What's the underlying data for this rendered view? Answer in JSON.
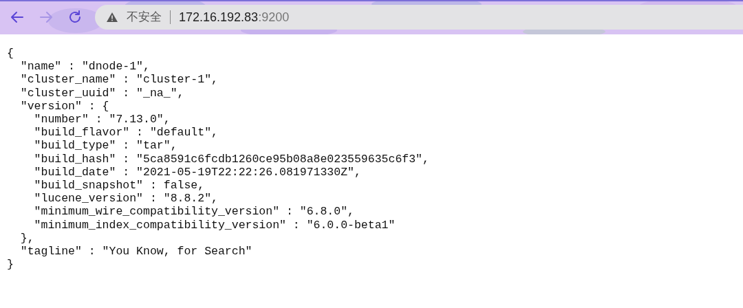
{
  "toolbar": {
    "back_enabled": true,
    "forward_enabled": false
  },
  "address_bar": {
    "security_label": "不安全",
    "host": "172.16.192.83",
    "port": ":9200"
  },
  "json_lines": [
    {
      "text": "{",
      "children": [
        {
          "text": "\"name\" : \"dnode-1\","
        },
        {
          "text": "\"cluster_name\" : \"cluster-1\","
        },
        {
          "text": "\"cluster_uuid\" : \"_na_\","
        },
        {
          "text": "\"version\" : {",
          "children": [
            {
              "text": "\"number\" : \"7.13.0\","
            },
            {
              "text": "\"build_flavor\" : \"default\","
            },
            {
              "text": "\"build_type\" : \"tar\","
            },
            {
              "text": "\"build_hash\" : \"5ca8591c6fcdb1260ce95b08a8e023559635c6f3\","
            },
            {
              "text": "\"build_date\" : \"2021-05-19T22:22:26.081971330Z\","
            },
            {
              "text": "\"build_snapshot\" : false,"
            },
            {
              "text": "\"lucene_version\" : \"8.8.2\","
            },
            {
              "text": "\"minimum_wire_compatibility_version\" : \"6.8.0\","
            },
            {
              "text": "\"minimum_index_compatibility_version\" : \"6.0.0-beta1\""
            }
          ]
        },
        {
          "text": "},"
        },
        {
          "text": "\"tagline\" : \"You Know, for Search\""
        }
      ]
    },
    {
      "text": "}"
    }
  ]
}
